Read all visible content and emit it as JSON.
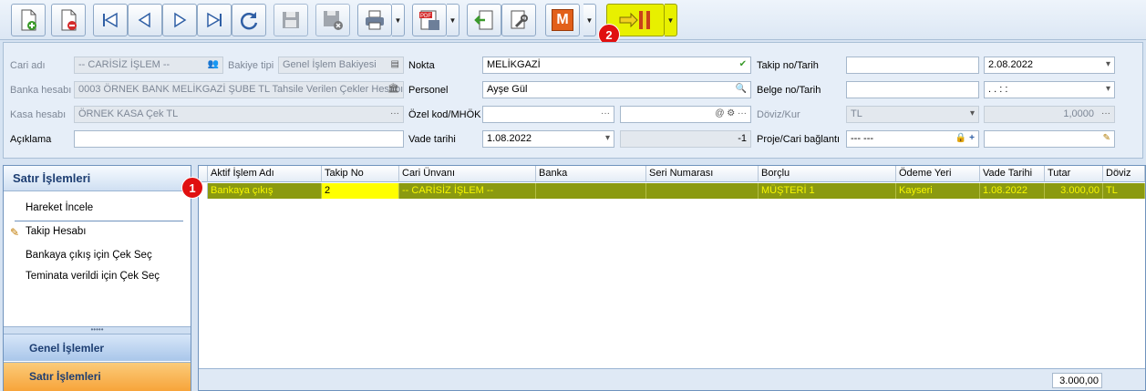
{
  "toolbar": {
    "buttons": [
      {
        "name": "new-document-button",
        "icon": "new-document-icon"
      },
      {
        "name": "delete-document-button",
        "icon": "delete-document-icon"
      },
      {
        "name": "first-record-button",
        "icon": "first-record-icon"
      },
      {
        "name": "previous-record-button",
        "icon": "previous-record-icon"
      },
      {
        "name": "next-record-button",
        "icon": "next-record-icon"
      },
      {
        "name": "last-record-button",
        "icon": "last-record-icon"
      },
      {
        "name": "refresh-button",
        "icon": "refresh-icon"
      },
      {
        "name": "save-button",
        "icon": "save-icon"
      },
      {
        "name": "save-close-button",
        "icon": "save-close-icon"
      },
      {
        "name": "print-button",
        "icon": "printer-icon"
      },
      {
        "name": "pdf-export-button",
        "icon": "pdf-icon",
        "text": "PDF"
      },
      {
        "name": "import-button",
        "icon": "import-icon"
      },
      {
        "name": "tools-button",
        "icon": "wrench-icon"
      },
      {
        "name": "m-button",
        "icon": "m-logo-icon",
        "text": "M"
      },
      {
        "name": "transfer-button",
        "icon": "transfer-arrow-icon"
      }
    ],
    "badge2": "2"
  },
  "form": {
    "cari_adi_label": "Cari adı",
    "cari_adi_value": "-- CARİSİZ İŞLEM --",
    "bakiye_tipi_label": "Bakiye tipi",
    "bakiye_tipi_value": "Genel İşlem Bakiyesi",
    "banka_hesabi_label": "Banka hesabı",
    "banka_hesabi_value": "0003 ÖRNEK BANK MELİKGAZİ ŞUBE TL Tahsile Verilen Çekler Hesabı",
    "kasa_hesabi_label": "Kasa hesabı",
    "kasa_hesabi_value": "ÖRNEK KASA Çek TL",
    "aciklama_label": "Açıklama",
    "aciklama_value": "",
    "nokta_label": "Nokta",
    "nokta_value": "MELİKGAZİ",
    "personel_label": "Personel",
    "personel_value": "Ayşe Gül",
    "ozel_kod_label": "Özel kod/MHÖK",
    "ozel_kod_value": "",
    "mhok_value": "",
    "vade_tarihi_label": "Vade tarihi",
    "vade_tarihi_value": "1.08.2022",
    "vade_gun_value": "-1",
    "takip_no_label": "Takip no/Tarih",
    "takip_no_value": "",
    "takip_tarih_value": "2.08.2022",
    "belge_no_label": "Belge no/Tarih",
    "belge_no_value": "",
    "belge_tarih_value": ". .   : :",
    "doviz_kur_label": "Döviz/Kur",
    "doviz_value": "TL",
    "kur_value": "1,0000",
    "proje_label": "Proje/Cari bağlantı",
    "proje_value": "--- ---",
    "baglanti_value": ""
  },
  "left_panel": {
    "title": "Satır İşlemleri",
    "items": [
      {
        "label": "Hareket İncele"
      },
      {
        "label": "Takip Hesabı"
      },
      {
        "label": "Bankaya çıkış için Çek Seç"
      },
      {
        "label": "Teminata verildi için Çek Seç"
      }
    ],
    "grip": "•••••",
    "tab_genel": "Genel İşlemler",
    "tab_satir": "Satır İşlemleri"
  },
  "grid": {
    "columns": [
      "Aktif İşlem Adı",
      "Takip No",
      "Cari Ünvanı",
      "Banka",
      "Seri Numarası",
      "Borçlu",
      "Ödeme Yeri",
      "Vade Tarihi",
      "Tutar",
      "Döviz"
    ],
    "rows": [
      {
        "aktif_islem": "Bankaya çıkış",
        "takip_no": "2",
        "cari_unvani": "-- CARİSİZ İŞLEM --",
        "banka": "",
        "seri_no": "",
        "borclu": "MÜŞTERİ 1",
        "odeme_yeri": "Kayseri",
        "vade_tarihi": "1.08.2022",
        "tutar": "3.000,00",
        "doviz": "TL"
      }
    ],
    "total": "3.000,00",
    "badge1": "1"
  },
  "colors": {
    "row_bg": "#8b9a10",
    "row_text": "#f7f700",
    "selected_cell": "#ffff00",
    "badge": "#e01010",
    "tab_genel_bg": "#a9c6ea",
    "tab_satir_bg": "#f7a43a"
  }
}
